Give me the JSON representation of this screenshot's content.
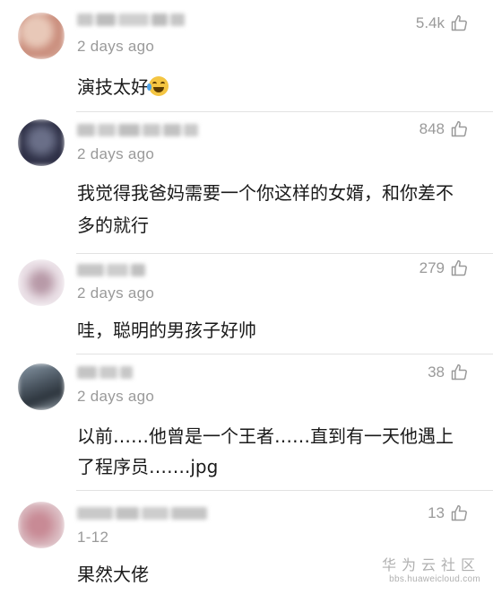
{
  "comments": [
    {
      "time": "2 days ago",
      "likes": "5.4k",
      "text": "演技太好"
    },
    {
      "time": "2 days ago",
      "likes": "848",
      "text": "我觉得我爸妈需要一个你这样的女婿，和你差不多的就行"
    },
    {
      "time": "2 days ago",
      "likes": "279",
      "text": "哇，聪明的男孩子好帅"
    },
    {
      "time": "2 days ago",
      "likes": "38",
      "text": "以前……他曾是一个王者……直到有一天他遇上了程序员…….jpg"
    },
    {
      "time": "1-12",
      "likes": "13",
      "text": "果然大佬"
    }
  ],
  "watermark": {
    "title": "华为云社区",
    "url": "bbs.huaweicloud.com"
  },
  "icons": {
    "like": "thumbs-up-outline-icon",
    "emoji": "laughing-tears-emoji-icon"
  },
  "colors": {
    "meta_text": "#9a9a9a",
    "divider": "#e2e2e2",
    "body_text": "#1a1a1a"
  }
}
